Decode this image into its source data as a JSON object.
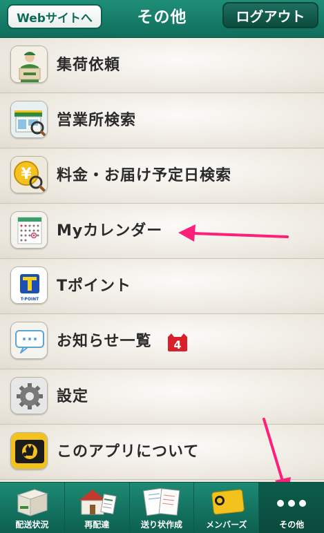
{
  "header": {
    "web_button": "Webサイトへ",
    "title": "その他",
    "logout_button": "ログアウト"
  },
  "menu": {
    "items": [
      {
        "label": "集荷依頼",
        "icon": "delivery-person-icon"
      },
      {
        "label": "営業所検索",
        "icon": "store-search-icon"
      },
      {
        "label": "料金・お届け予定日検索",
        "icon": "yen-search-icon"
      },
      {
        "label": "Myカレンダー",
        "icon": "calendar-icon"
      },
      {
        "label": "Tポイント",
        "icon": "t-point-icon"
      },
      {
        "label": "お知らせ一覧",
        "icon": "speech-bubble-icon",
        "badge": "4"
      },
      {
        "label": "設定",
        "icon": "gear-icon"
      },
      {
        "label": "このアプリについて",
        "icon": "black-cat-logo-icon"
      }
    ]
  },
  "tabbar": {
    "tabs": [
      {
        "label": "配送状況",
        "icon": "package-icon"
      },
      {
        "label": "再配達",
        "icon": "house-icon"
      },
      {
        "label": "送り状作成",
        "icon": "waybill-icon"
      },
      {
        "label": "メンバーズ",
        "icon": "member-card-icon"
      },
      {
        "label": "その他",
        "icon": "more-dots-icon",
        "active": true
      }
    ]
  },
  "colors": {
    "brand_green": "#14806a",
    "badge_red": "#d8202a",
    "annotation_pink": "#ff1e78"
  }
}
